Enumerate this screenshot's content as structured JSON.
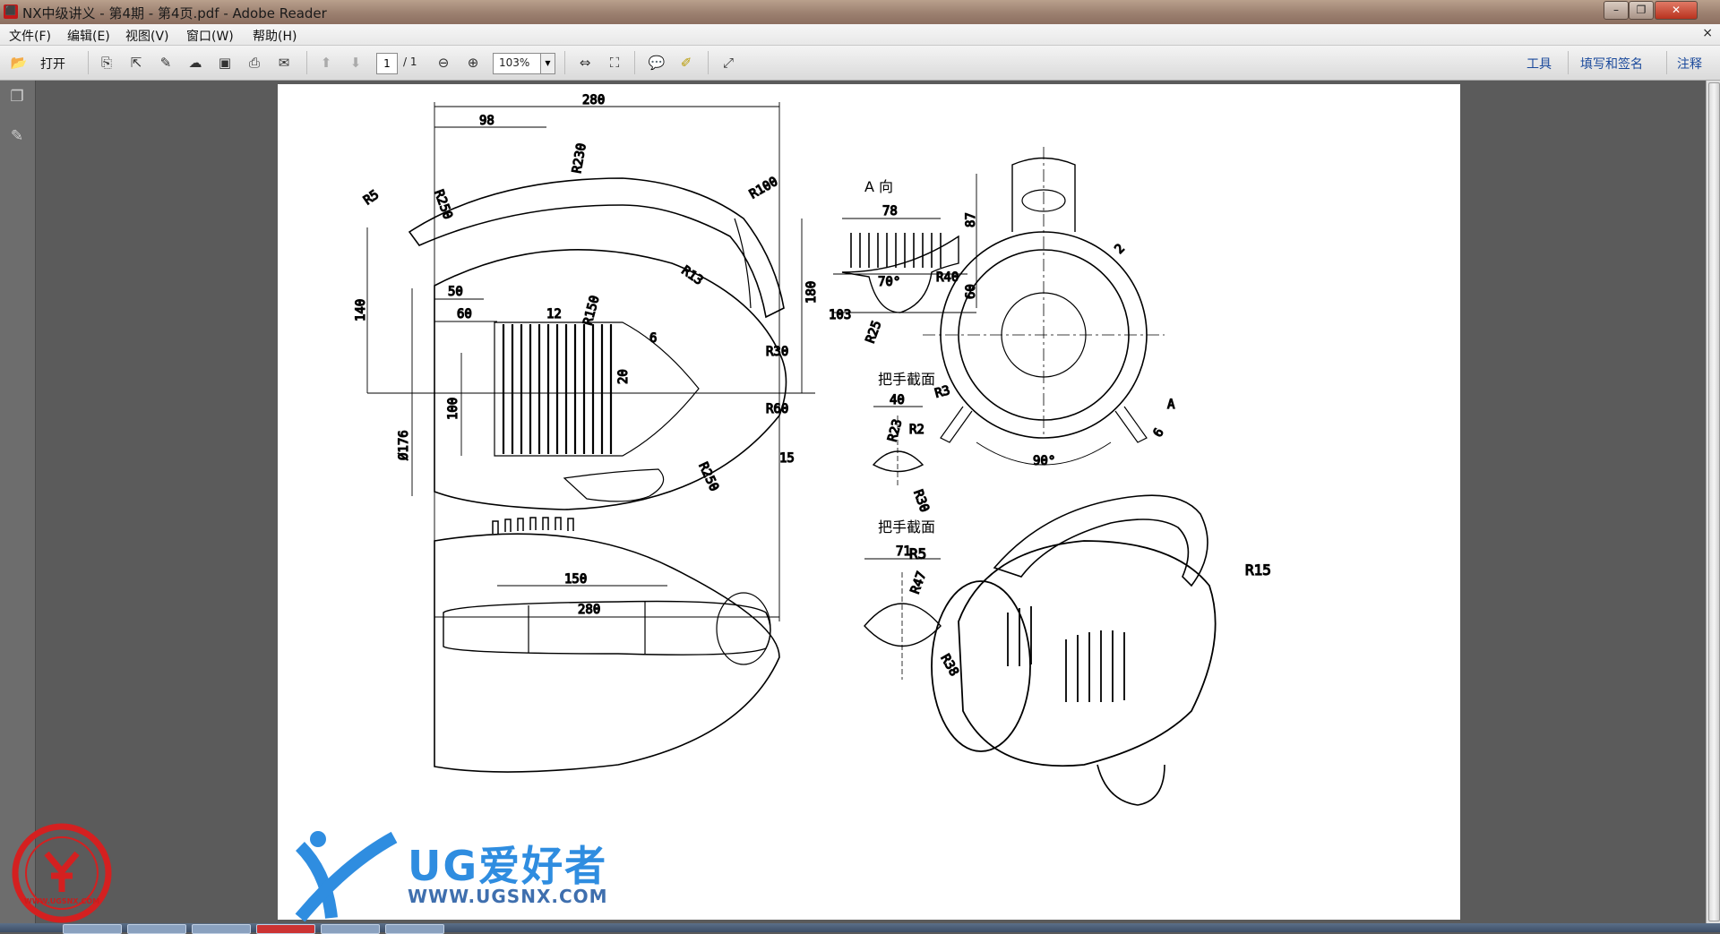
{
  "window": {
    "title": "NX中级讲义 - 第4期 - 第4页.pdf - Adobe Reader",
    "controls": {
      "minimize": "–",
      "maximize": "❐",
      "close": "✕"
    }
  },
  "menu": {
    "items": [
      {
        "label": "文件(F)"
      },
      {
        "label": "编辑(E)"
      },
      {
        "label": "视图(V)"
      },
      {
        "label": "窗口(W)"
      },
      {
        "label": "帮助(H)"
      }
    ],
    "close_doc": "×"
  },
  "toolbar": {
    "open_label": "打开",
    "page_current": "1",
    "page_total": "/ 1",
    "zoom": "103%",
    "right_links": [
      {
        "label": "工具"
      },
      {
        "label": "填写和签名"
      },
      {
        "label": "注释"
      }
    ]
  },
  "drawing": {
    "top_view": {
      "dims": [
        "280",
        "98",
        "R230",
        "R250",
        "R5",
        "R100",
        "50",
        "60",
        "12",
        "R150",
        "R13",
        "6",
        "R30",
        "140",
        "180",
        "100",
        "20",
        "R60",
        "Ø176",
        "15",
        "R250",
        "150",
        "280"
      ]
    },
    "view_a": {
      "title": "A 向",
      "dims": [
        "78",
        "87",
        "70°",
        "R40",
        "60",
        "103",
        "R25"
      ]
    },
    "section_1": {
      "title": "把手截面",
      "dims": [
        "40",
        "R23",
        "R30"
      ]
    },
    "section_2": {
      "title": "把手截面",
      "dims": [
        "71",
        "R47",
        "R38"
      ]
    },
    "front_view": {
      "dims": [
        "2",
        "R3",
        "R2",
        "A",
        "6",
        "90°"
      ]
    },
    "iso_view": {
      "dims": [
        "R5",
        "R15"
      ]
    }
  },
  "watermark": {
    "brand": "UG爱好者",
    "url": "WWW.UGSNX.COM",
    "seal_text": "UG爱好者",
    "seal_url": "WWW.UGSNX.COM"
  }
}
